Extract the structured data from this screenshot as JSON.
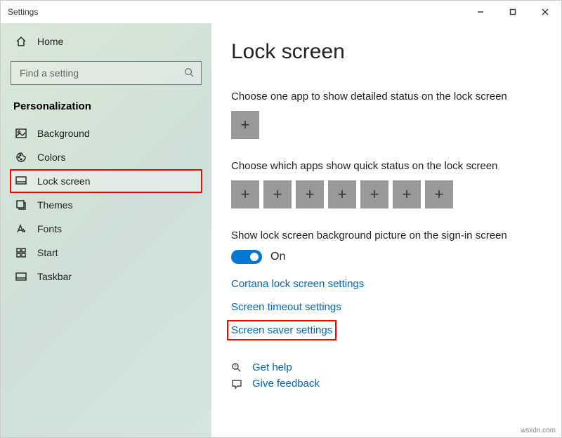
{
  "window": {
    "title": "Settings"
  },
  "sidebar": {
    "home": "Home",
    "search_placeholder": "Find a setting",
    "section": "Personalization",
    "items": [
      {
        "label": "Background"
      },
      {
        "label": "Colors"
      },
      {
        "label": "Lock screen"
      },
      {
        "label": "Themes"
      },
      {
        "label": "Fonts"
      },
      {
        "label": "Start"
      },
      {
        "label": "Taskbar"
      }
    ]
  },
  "main": {
    "title": "Lock screen",
    "detailed_label": "Choose one app to show detailed status on the lock screen",
    "quick_label": "Choose which apps show quick status on the lock screen",
    "signin_label": "Show lock screen background picture on the sign-in screen",
    "toggle_state": "On",
    "links": {
      "cortana": "Cortana lock screen settings",
      "timeout": "Screen timeout settings",
      "saver": "Screen saver settings"
    },
    "help": "Get help",
    "feedback": "Give feedback"
  },
  "watermark": "wsxdn.com"
}
